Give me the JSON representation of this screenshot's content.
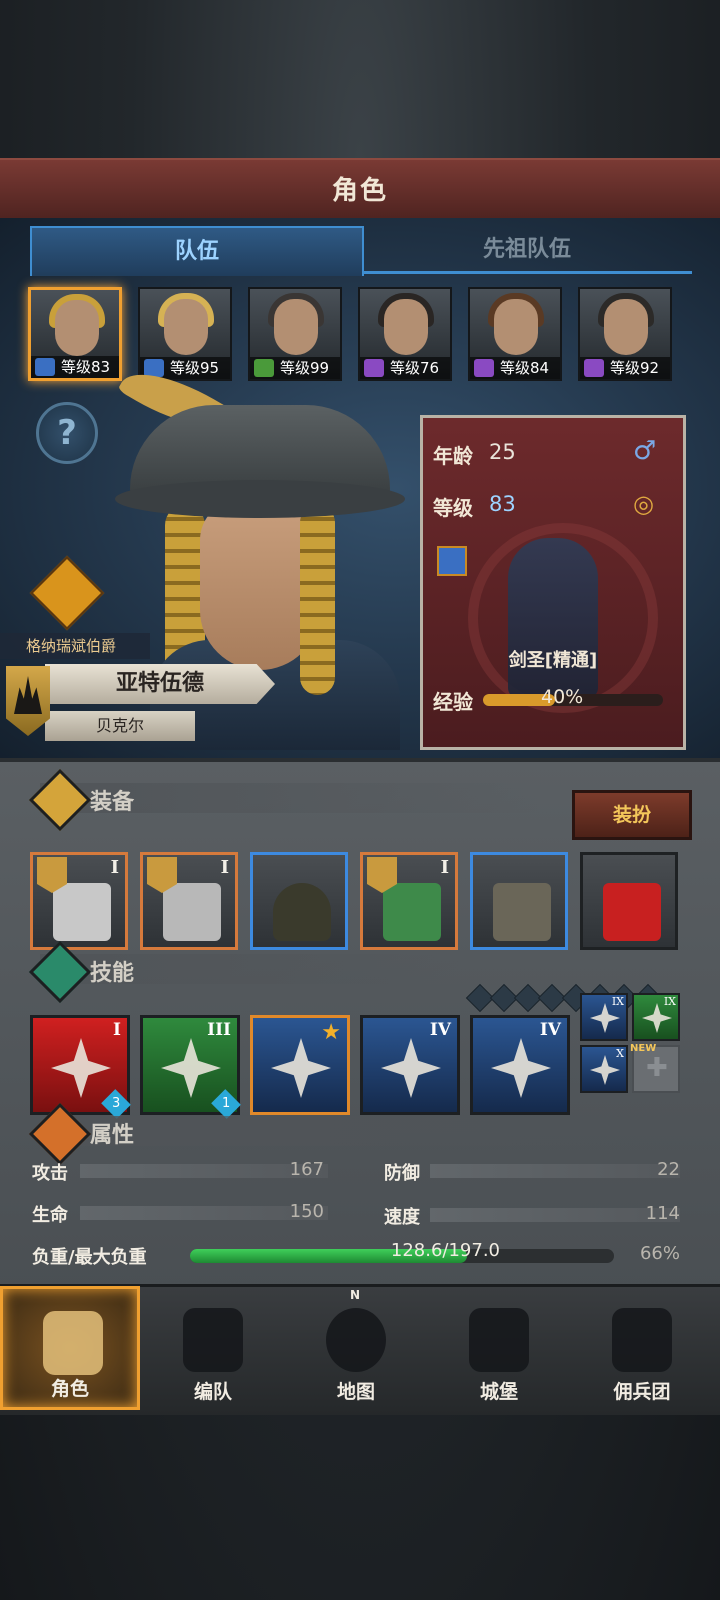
{
  "title": "角色",
  "tabs": [
    {
      "label": "队伍"
    },
    {
      "label": "先祖队伍"
    }
  ],
  "party": [
    {
      "level_text": "等级83",
      "icon": "sword-class-icon",
      "color": "#3a6fc2",
      "hair": "#c9a03a",
      "selected": true
    },
    {
      "level_text": "等级95",
      "icon": "sword-class-icon",
      "color": "#3a6fc2",
      "hair": "#d6b254"
    },
    {
      "level_text": "等级99",
      "icon": "green-blade-class-icon",
      "color": "#4a9a3a",
      "hair": "#3a3634"
    },
    {
      "level_text": "等级76",
      "icon": "staff-class-icon",
      "color": "#8a4ac2",
      "hair": "#2a2624"
    },
    {
      "level_text": "等级84",
      "icon": "staff-class-icon",
      "color": "#8a4ac2",
      "hair": "#5a3a24"
    },
    {
      "level_text": "等级92",
      "icon": "staff-class-icon",
      "color": "#8a4ac2",
      "hair": "#2c2a28"
    }
  ],
  "character": {
    "title": "格纳瑞斌伯爵",
    "name": "亚特伍德",
    "house": "贝克尔",
    "age_label": "年龄",
    "age": "25",
    "level_label": "等级",
    "level": "83",
    "class_name": "剑圣[精通]",
    "exp_label": "经验",
    "exp_percent": "40%",
    "exp_fraction": 0.4
  },
  "equipment": {
    "section_label": "装备",
    "dress_button": "装扮",
    "slots": [
      {
        "name": "axe-weapon-1",
        "border": "orange",
        "tier": "I",
        "badge": true
      },
      {
        "name": "axe-weapon-2",
        "border": "orange",
        "tier": "I",
        "badge": true
      },
      {
        "name": "hood",
        "border": "blue",
        "tier": "",
        "badge": false
      },
      {
        "name": "armor",
        "border": "orange",
        "tier": "I",
        "badge": true
      },
      {
        "name": "boots",
        "border": "blue",
        "tier": "",
        "badge": false
      },
      {
        "name": "knot-accessory",
        "border": "dark",
        "tier": "",
        "badge": false
      }
    ]
  },
  "skills": {
    "section_label": "技能",
    "items": [
      {
        "color": "red",
        "tier": "I",
        "count": "3"
      },
      {
        "color": "green",
        "tier": "III",
        "count": "1"
      },
      {
        "color": "blue",
        "tier": "",
        "star": true
      },
      {
        "color": "blue",
        "tier": "IV"
      },
      {
        "color": "blue",
        "tier": "IV"
      }
    ],
    "mini": [
      {
        "color": "blue",
        "tier": "IX"
      },
      {
        "color": "green",
        "tier": "IX"
      },
      {
        "color": "blue",
        "tier": "X"
      }
    ],
    "new_label": "NEW"
  },
  "attributes": {
    "section_label": "属性",
    "attack_label": "攻击",
    "attack": "167",
    "defense_label": "防御",
    "defense": "22",
    "hp_label": "生命",
    "hp": "150",
    "speed_label": "速度",
    "speed": "114",
    "load_label": "负重/最大负重",
    "load_text": "128.6/197.0",
    "load_percent": "66%",
    "load_fraction": 0.653
  },
  "nav": [
    {
      "label": "角色",
      "selected": true
    },
    {
      "label": "编队"
    },
    {
      "label": "地图"
    },
    {
      "label": "城堡"
    },
    {
      "label": "佣兵团"
    }
  ],
  "compass_letter": "N"
}
